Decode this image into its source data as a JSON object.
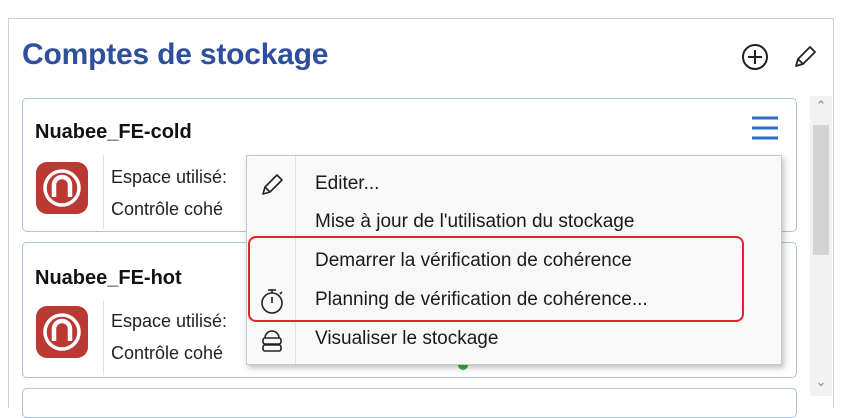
{
  "header": {
    "title": "Comptes de stockage",
    "add_icon": "plus-circle-icon",
    "edit_icon": "pencil-icon"
  },
  "cards": [
    {
      "name": "Nuabee_FE-cold",
      "space_label": "Espace utilisé:",
      "check_label": "Contrôle cohé"
    },
    {
      "name": "Nuabee_FE-hot",
      "space_label": "Espace utilisé:",
      "check_label": "Contrôle cohé"
    }
  ],
  "context_menu": {
    "items": [
      {
        "label": "Editer...",
        "icon": "pencil-icon"
      },
      {
        "label": "Mise à jour de l'utilisation du stockage",
        "icon": ""
      },
      {
        "label": "Demarrer la vérification de cohérence",
        "icon": ""
      },
      {
        "label": "Planning de vérification de cohérence...",
        "icon": "stopwatch-icon"
      },
      {
        "label": "Visualiser le stockage",
        "icon": "storage-icon"
      }
    ]
  },
  "colors": {
    "title": "#2e4f9c",
    "brand_logo": "#b83a32",
    "card_border": "#a9c3e3",
    "highlight": "#e5232f"
  }
}
